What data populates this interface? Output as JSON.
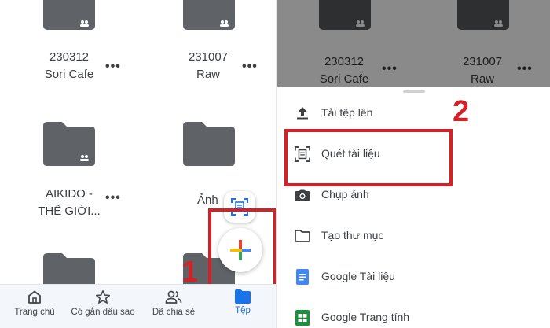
{
  "left": {
    "folders": [
      {
        "name_line1": "230312",
        "name_line2": "Sori Cafe"
      },
      {
        "name_line1": "231007",
        "name_line2": "Raw"
      },
      {
        "name_line1": "AIKIDO -",
        "name_line2": "THẾ GIỚI..."
      },
      {
        "name_line1": "Ảnh",
        "name_line2": ""
      }
    ],
    "more_label": "•••",
    "nav": [
      {
        "label": "Trang chủ",
        "icon": "home-icon"
      },
      {
        "label": "Có gắn dấu sao",
        "icon": "star-icon"
      },
      {
        "label": "Đã chia sẻ",
        "icon": "people-icon"
      },
      {
        "label": "Tệp",
        "icon": "folder-icon"
      }
    ],
    "step_number": "1"
  },
  "right": {
    "folders": [
      {
        "name_line1": "230312",
        "name_line2": "Sori Cafe"
      },
      {
        "name_line1": "231007",
        "name_line2": "Raw"
      }
    ],
    "menu": [
      {
        "label": "Tải tệp lên",
        "icon": "upload-icon"
      },
      {
        "label": "Quét tài liệu",
        "icon": "scan-document-icon"
      },
      {
        "label": "Chụp ảnh",
        "icon": "camera-icon"
      },
      {
        "label": "Tạo thư mục",
        "icon": "folder-outline-icon"
      },
      {
        "label": "Google Tài liệu",
        "icon": "google-docs-icon"
      },
      {
        "label": "Google Trang tính",
        "icon": "google-sheets-icon"
      }
    ],
    "step_number": "2"
  },
  "colors": {
    "folder": "#5f6368",
    "highlight": "#d32128",
    "active_nav": "#1a73e8",
    "docs_blue": "#4285f4",
    "sheets_green": "#1e8e3e"
  }
}
